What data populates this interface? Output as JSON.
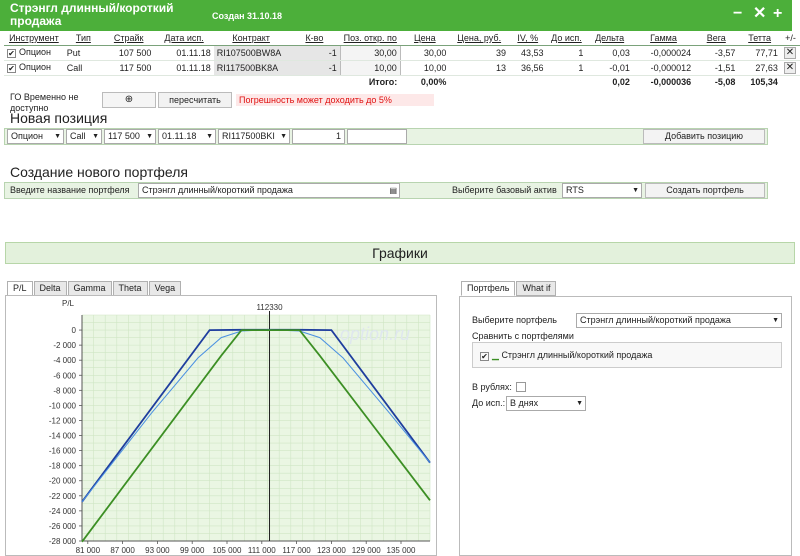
{
  "header": {
    "title": "Стрэнгл длинный/короткий продажа",
    "created": "Создан 31.10.18",
    "minimize": "−",
    "close": "✕",
    "add": "+"
  },
  "table": {
    "columns": [
      "Инструмент",
      "Тип",
      "Страйк",
      "Дата исп.",
      "Контракт",
      "К-во",
      "Поз. откр. по",
      "Цена",
      "Цена, руб.",
      "IV, %",
      "До исп.",
      "Дельта",
      "Гамма",
      "Вега",
      "Тетта",
      "+/-"
    ],
    "rows": [
      {
        "instrument": "Опцион",
        "type": "Put",
        "strike": "107 500",
        "date": "01.11.18",
        "contract": "RI107500BW8A",
        "qty": "-1",
        "open": "30,00",
        "price": "30,00",
        "price_rub": "39",
        "iv": "43,53",
        "days": "1",
        "delta": "0,03",
        "gamma": "-0,000024",
        "vega": "-3,57",
        "theta": "77,71"
      },
      {
        "instrument": "Опцион",
        "type": "Call",
        "strike": "117 500",
        "date": "01.11.18",
        "contract": "RI117500BK8A",
        "qty": "-1",
        "open": "10,00",
        "price": "10,00",
        "price_rub": "13",
        "iv": "36,56",
        "days": "1",
        "delta": "-0,01",
        "gamma": "-0,000012",
        "vega": "-1,51",
        "theta": "27,63"
      }
    ],
    "total_label": "Итого:",
    "total_pct": "0,00%",
    "total_delta": "0,02",
    "total_gamma": "-0,000036",
    "total_vega": "-5,08",
    "total_theta": "105,34"
  },
  "go": {
    "label": "ГО Временно не доступно",
    "button": "⊕",
    "recalc": "пересчитать",
    "warning": "Погрешность может доходить до 5%"
  },
  "new_position": {
    "title": "Новая позиция",
    "instrument": "Опцион",
    "type": "Call",
    "strike": "117 500",
    "date": "01.11.18",
    "contract": "RI117500BKI",
    "qty": "1",
    "add_button": "Добавить позицию"
  },
  "new_portfolio": {
    "title": "Создание нового портфеля",
    "name_label": "Введите название портфеля",
    "name_value": "Стрэнгл длинный/короткий продажа",
    "asset_label": "Выберите базовый актив",
    "asset_value": "RTS",
    "create_button": "Создать портфель"
  },
  "graphs": {
    "title": "Графики",
    "tabs": [
      "P/L",
      "Delta",
      "Gamma",
      "Theta",
      "Vega"
    ],
    "right_tabs": [
      "Портфель",
      "What if"
    ]
  },
  "right_panel": {
    "select_label": "Выберите портфель",
    "select_value": "Стрэнгл длинный/короткий продажа",
    "compare_label": "Сравнить с портфелями",
    "compare_item": "Стрэнгл длинный/короткий продажа",
    "rub_label": "В рублях:",
    "until_label": "До исп.:",
    "until_value": "В днях"
  },
  "chart_data": {
    "type": "line",
    "ylabel": "P/L",
    "current_price_label": "112330",
    "watermark": "option.ru",
    "xlim": [
      80000,
      140000
    ],
    "ylim": [
      -28000,
      2000
    ],
    "x_ticks": [
      "81 000",
      "87 000",
      "93 000",
      "99 000",
      "105 000",
      "111 000",
      "117 000",
      "123 000",
      "129 000",
      "135 000"
    ],
    "y_ticks": [
      "0",
      "-2 000",
      "-4 000",
      "-6 000",
      "-8 000",
      "-10 000",
      "-12 000",
      "-14 000",
      "-16 000",
      "-18 000",
      "-20 000",
      "-22 000",
      "-24 000",
      "-26 000",
      "-28 000"
    ],
    "current_price": 112330,
    "colors": {
      "expiry": "#1f3e9e",
      "today": "#4a90e2",
      "compare": "#3c8f24",
      "grid_fill": "#eaf6e3"
    },
    "series": [
      {
        "x": [
          80000,
          102000,
          107500,
          117500,
          123000,
          140000
        ],
        "y": [
          -22800,
          0,
          40,
          40,
          0,
          -17600
        ]
      },
      {
        "x": [
          80000,
          92000,
          100000,
          104000,
          107500,
          112330,
          117500,
          121000,
          125000,
          133000,
          140000
        ],
        "y": [
          -22800,
          -11000,
          -3700,
          -1000,
          -120,
          30,
          -120,
          -1000,
          -3700,
          -11000,
          -17600
        ]
      },
      {
        "x": [
          80000,
          104000,
          107500,
          117500,
          121000,
          140000
        ],
        "y": [
          -28100,
          -3400,
          0,
          0,
          -3400,
          -22600
        ]
      }
    ]
  }
}
